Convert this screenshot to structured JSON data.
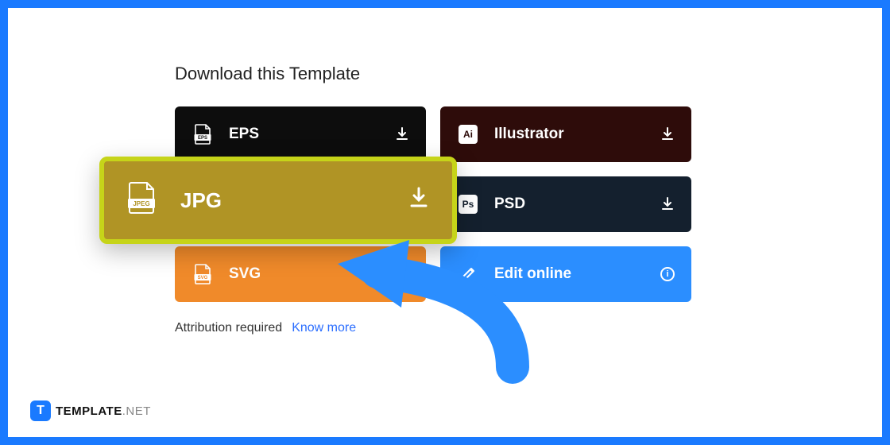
{
  "heading": "Download this Template",
  "buttons": {
    "eps": {
      "label": "EPS",
      "icon": "eps-file"
    },
    "illustrator": {
      "label": "Illustrator",
      "icon": "ai-badge"
    },
    "jpg": {
      "label": "JPG",
      "icon": "jpeg-file"
    },
    "psd": {
      "label": "PSD",
      "icon": "ps-badge"
    },
    "svg": {
      "label": "SVG",
      "icon": "svg-file"
    },
    "edit": {
      "label": "Edit online",
      "icon": "pencil"
    }
  },
  "attribution": {
    "text": "Attribution required",
    "link": "Know more"
  },
  "logo": {
    "mark": "T",
    "name": "TEMPLATE",
    "suffix": ".NET"
  },
  "colors": {
    "frame": "#1a7aff",
    "jpg_bg": "#b09425",
    "jpg_border": "#c6d419",
    "svg_bg": "#f08a2a",
    "edit_bg": "#2b8eff",
    "arrow": "#2b8eff"
  }
}
